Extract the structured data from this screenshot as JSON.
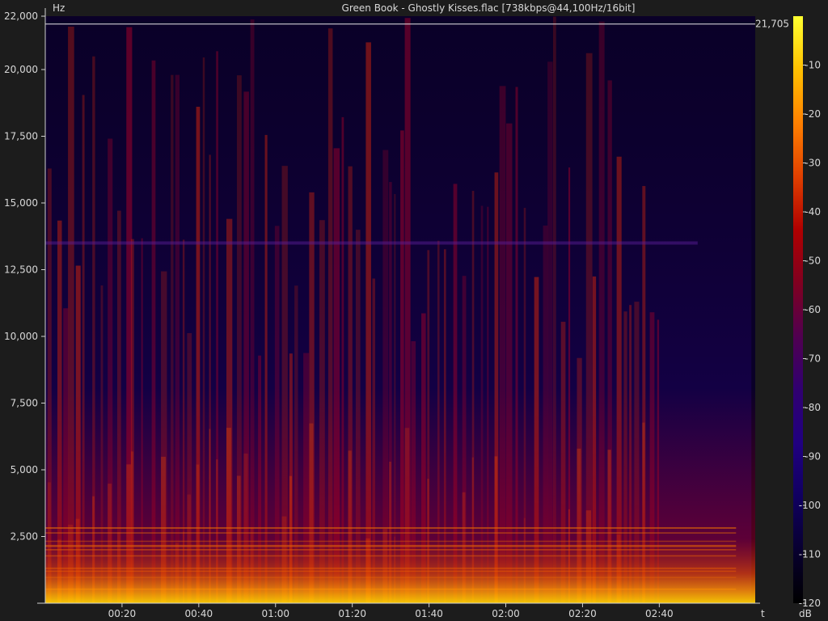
{
  "window": {
    "title": "Green Book - Ghostly Kisses.flac [738kbps@44,100Hz/16bit]"
  },
  "chart_data": {
    "type": "heatmap",
    "title": "Green Book - Ghostly Kisses.flac [738kbps@44,100Hz/16bit]",
    "ylabel": "Hz",
    "xlabel": "t",
    "colorbar_label": "dB",
    "ylim": [
      0,
      22000
    ],
    "yticks": [
      2500,
      5000,
      7500,
      10000,
      12500,
      15000,
      17500,
      20000,
      22000
    ],
    "ytick_labels": [
      "2,500",
      "5,000",
      "7,500",
      "10,000",
      "12,500",
      "15,000",
      "17,500",
      "20,000",
      "22,000"
    ],
    "xlim_seconds": [
      0,
      185
    ],
    "xticks_seconds": [
      20,
      40,
      60,
      80,
      100,
      120,
      140,
      160
    ],
    "xtick_labels": [
      "00:20",
      "00:40",
      "01:00",
      "01:20",
      "01:40",
      "02:00",
      "02:20",
      "02:40"
    ],
    "cursor_frequency_hz": 21705,
    "cursor_label": "21,705",
    "colorbar": {
      "range_db": [
        -120,
        0
      ],
      "ticks_db": [
        -10,
        -20,
        -30,
        -40,
        -50,
        -60,
        -70,
        -80,
        -90,
        -100,
        -110,
        -120
      ],
      "tick_labels": [
        "-10",
        "-20",
        "-30",
        "-40",
        "-50",
        "-60",
        "-70",
        "-80",
        "-90",
        "-100",
        "-110",
        "-120"
      ],
      "colors": [
        "#ffff30",
        "#ffc000",
        "#ff8000",
        "#e04000",
        "#b00000",
        "#800020",
        "#500050",
        "#300070",
        "#200080",
        "#100060",
        "#080030",
        "#000000"
      ]
    },
    "content_end_seconds": 184,
    "signal_end_seconds": 160,
    "band_line_hz": 13500
  }
}
